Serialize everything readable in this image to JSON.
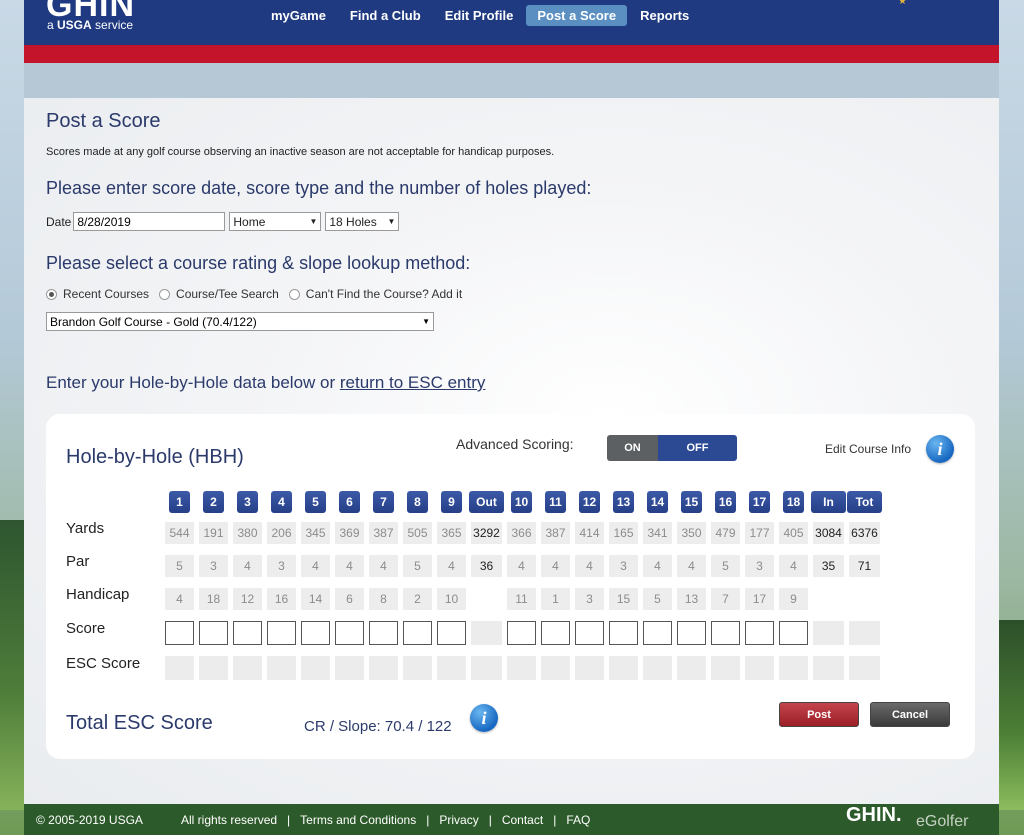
{
  "header": {
    "logo": "GHIN",
    "logo_sub_prefix": "a ",
    "logo_sub_brand": "USGA",
    "logo_sub_suffix": " service",
    "nav": [
      "myGame",
      "Find a Club",
      "Edit Profile",
      "Post a Score",
      "Reports"
    ],
    "active_nav": "Post a Score"
  },
  "page": {
    "title": "Post a Score",
    "notice": "Scores made at any golf course observing an inactive season are not acceptable for handicap purposes.",
    "section1": "Please enter score date, score type and the number of holes played:",
    "date_label": "Date",
    "date_value": "8/28/2019",
    "score_type": "Home",
    "holes_played": "18 Holes",
    "section2": "Please select a course rating & slope lookup method:",
    "methods": [
      "Recent Courses",
      "Course/Tee Search",
      "Can't Find the Course? Add it"
    ],
    "selected_method": "Recent Courses",
    "course": "Brandon Golf Course - Gold (70.4/122)",
    "hbh_intro": "Enter your Hole-by-Hole data below or ",
    "hbh_link": "return to ESC entry"
  },
  "card": {
    "title": "Hole-by-Hole (HBH)",
    "advanced_label": "Advanced Scoring:",
    "toggle_on": "ON",
    "toggle_off": "OFF",
    "toggle_state": "OFF",
    "edit_course_info": "Edit Course Info",
    "info_glyph": "i",
    "row_labels": [
      "Yards",
      "Par",
      "Handicap",
      "Score",
      "ESC Score"
    ],
    "columns": [
      "1",
      "2",
      "3",
      "4",
      "5",
      "6",
      "7",
      "8",
      "9",
      "Out",
      "10",
      "11",
      "12",
      "13",
      "14",
      "15",
      "16",
      "17",
      "18",
      "In",
      "Tot"
    ],
    "yards": [
      "544",
      "191",
      "380",
      "206",
      "345",
      "369",
      "387",
      "505",
      "365",
      "3292",
      "366",
      "387",
      "414",
      "165",
      "341",
      "350",
      "479",
      "177",
      "405",
      "3084",
      "6376"
    ],
    "par": [
      "5",
      "3",
      "4",
      "3",
      "4",
      "4",
      "4",
      "5",
      "4",
      "36",
      "4",
      "4",
      "4",
      "3",
      "4",
      "4",
      "5",
      "3",
      "4",
      "35",
      "71"
    ],
    "handicap": [
      "4",
      "18",
      "12",
      "16",
      "14",
      "6",
      "8",
      "2",
      "10",
      "",
      "11",
      "1",
      "3",
      "15",
      "5",
      "13",
      "7",
      "17",
      "9",
      "",
      ""
    ],
    "total_esc_label": "Total ESC Score",
    "cr_slope": "CR / Slope: 70.4 / 122",
    "post_label": "Post",
    "cancel_label": "Cancel"
  },
  "footer": {
    "copyright": "© 2005-2019 USGA",
    "links": [
      "All rights reserved",
      "Terms and Conditions",
      "Privacy",
      "Contact",
      "FAQ"
    ],
    "logo": "GHIN.",
    "egolfer": "eGolfer"
  },
  "colors": {
    "header": "#1f3a80",
    "red_bar": "#c4142b",
    "active_nav": "#5b8fc2",
    "hole_header": "#2c4a94",
    "post_button": "#a8262e",
    "footer": "#2d5a2a"
  },
  "icons": [
    "info-icon",
    "radio-icon",
    "dropdown-arrow-icon"
  ]
}
